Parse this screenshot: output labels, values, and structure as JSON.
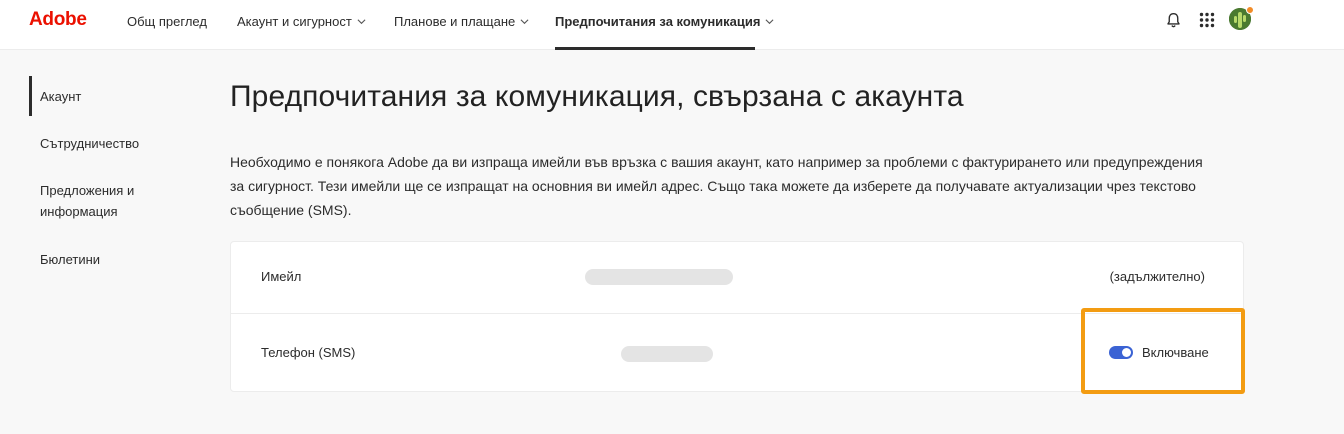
{
  "header": {
    "logo": "Adobe",
    "nav": [
      {
        "label": "Общ преглед"
      },
      {
        "label": "Акаунт и сигурност"
      },
      {
        "label": "Планове и плащане"
      },
      {
        "label": "Предпочитания за комуникация"
      }
    ],
    "icons": [
      "bell-icon",
      "apps-grid-icon",
      "avatar"
    ]
  },
  "sidebar": {
    "items": [
      {
        "label": "Акаунт"
      },
      {
        "label": "Сътрудничество"
      },
      {
        "label": "Предложения и информация"
      },
      {
        "label": "Бюлетини"
      }
    ]
  },
  "main": {
    "title": "Предпочитания за комуникация, свързана с акаунта",
    "description": "Необходимо е понякога Adobe да ви изпраща имейли във връзка с вашия акаунт, като например за проблеми с фактурирането или предупреждения за сигурност. Тези имейли ще се изпращат на основния ви имейл адрес. Също така можете да изберете да получавате актуализации чрез текстово съобщение (SMS).",
    "rows": [
      {
        "label": "Имейл",
        "status": "(задължително)"
      },
      {
        "label": "Телефон (SMS)",
        "toggle_label": "Включване",
        "toggle_on": true
      }
    ]
  },
  "colors": {
    "brand": "#eb1000",
    "toggle": "#3b63d4",
    "highlight": "#f39c12"
  }
}
